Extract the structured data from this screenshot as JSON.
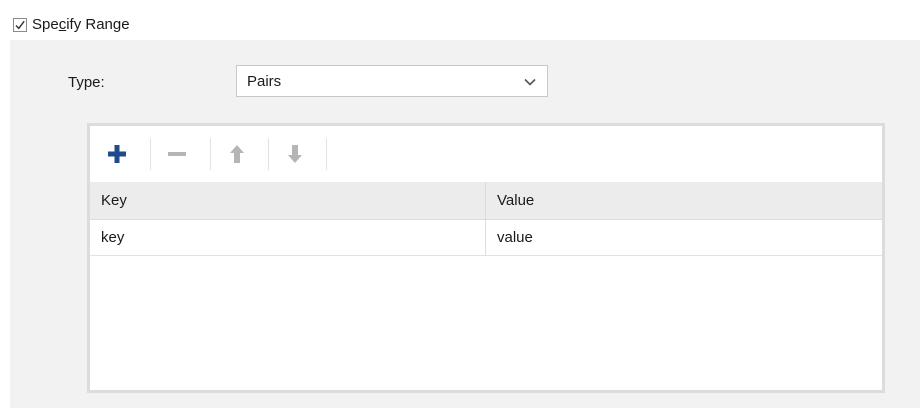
{
  "specify_range": {
    "checked": true,
    "label_before": "Spe",
    "label_mnemonic": "c",
    "label_after": "ify Range"
  },
  "type_field": {
    "label": "Type:",
    "selected": "Pairs"
  },
  "toolbar": {
    "add_icon": "plus-icon",
    "remove_icon": "minus-icon",
    "up_icon": "arrow-up-icon",
    "down_icon": "arrow-down-icon",
    "accent_color": "#1f4a8c",
    "disabled_color": "#b5b5b5"
  },
  "table": {
    "columns": [
      "Key",
      "Value"
    ],
    "rows": [
      [
        "key",
        "value"
      ]
    ]
  }
}
